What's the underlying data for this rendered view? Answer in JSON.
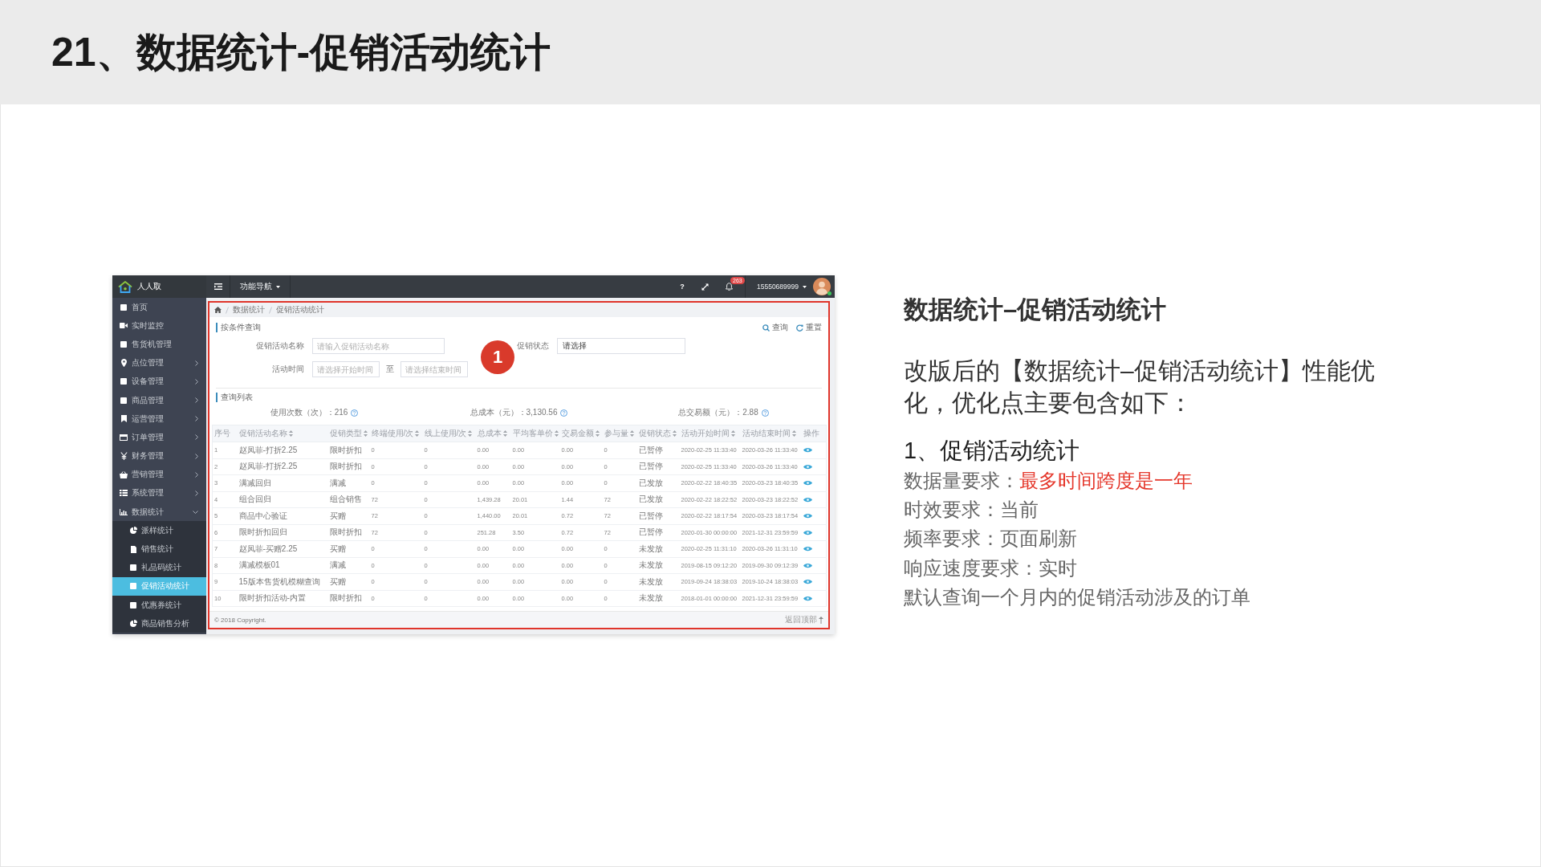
{
  "slide": {
    "title": "21、数据统计-促销活动统计"
  },
  "app": {
    "topbar": {
      "brand": "人人取",
      "nav_menu": "功能导航",
      "help": "?",
      "notification_count": "263",
      "user": "15550689999",
      "user_online": true
    },
    "sidebar": {
      "items": [
        {
          "label": "首页",
          "kind": "link",
          "selected": false
        },
        {
          "label": "实时监控",
          "kind": "link",
          "selected": false
        },
        {
          "label": "售货机管理",
          "kind": "link",
          "selected": false
        },
        {
          "label": "点位管理",
          "kind": "group",
          "expanded": false,
          "selected": false
        },
        {
          "label": "设备管理",
          "kind": "group",
          "expanded": false,
          "selected": false
        },
        {
          "label": "商品管理",
          "kind": "group",
          "expanded": false,
          "selected": false
        },
        {
          "label": "运营管理",
          "kind": "group",
          "expanded": false,
          "selected": false
        },
        {
          "label": "订单管理",
          "kind": "group",
          "expanded": false,
          "selected": false
        },
        {
          "label": "财务管理",
          "kind": "group",
          "expanded": false,
          "selected": false
        },
        {
          "label": "营销管理",
          "kind": "group",
          "expanded": false,
          "selected": false
        },
        {
          "label": "系统管理",
          "kind": "group",
          "expanded": false,
          "selected": false
        },
        {
          "label": "数据统计",
          "kind": "group",
          "expanded": true,
          "selected": false,
          "children": [
            {
              "label": "派样统计",
              "selected": false
            },
            {
              "label": "销售统计",
              "selected": false
            },
            {
              "label": "礼品码统计",
              "selected": false
            },
            {
              "label": "促销活动统计",
              "selected": true
            },
            {
              "label": "优惠券统计",
              "selected": false
            },
            {
              "label": "商品销售分析",
              "selected": false
            }
          ]
        }
      ]
    },
    "breadcrumb": [
      "数据统计",
      "促销活动统计"
    ],
    "search": {
      "title": "按条件查询",
      "buttons": [
        "查询",
        "重置"
      ],
      "fields": [
        {
          "kind": "text",
          "label": "促销活动名称",
          "placeholder": "请输入促销活动名称"
        },
        {
          "kind": "select",
          "label": "促销状态",
          "value": "请选择"
        },
        {
          "kind": "date-range",
          "label": "活动时间",
          "start": {
            "placeholder": "请选择开始时间"
          },
          "separator": "至",
          "end": {
            "placeholder": "请选择结束时间"
          }
        }
      ]
    },
    "list": {
      "title": "查询列表",
      "stats": [
        "使用次数（次）：216",
        "总成本（元）：3,130.56",
        "总交易额（元）：2.88"
      ],
      "table": {
        "columns": [
          {
            "label": "序号",
            "sortable": false
          },
          {
            "label": "促销活动名称",
            "sortable": true
          },
          {
            "label": "促销类型",
            "sortable": true
          },
          {
            "label": "终端使用/次",
            "sortable": true
          },
          {
            "label": "线上使用/次",
            "sortable": true
          },
          {
            "label": "总成本",
            "sortable": true
          },
          {
            "label": "平均客单价",
            "sortable": true
          },
          {
            "label": "交易金额",
            "sortable": true
          },
          {
            "label": "参与量",
            "sortable": true
          },
          {
            "label": "促销状态",
            "sortable": true
          },
          {
            "label": "活动开始时间",
            "sortable": true
          },
          {
            "label": "活动结束时间",
            "sortable": true
          },
          {
            "label": "操作",
            "sortable": false
          }
        ],
        "rows": [
          [
            "1",
            "赵凤菲-打折2.25",
            "限时折扣",
            "0",
            "0",
            "0.00",
            "0.00",
            "0.00",
            "0",
            "已暂停",
            "2020-02-25 11:33:40",
            "2020-03-26 11:33:40"
          ],
          [
            "2",
            "赵凤菲-打折2.25",
            "限时折扣",
            "0",
            "0",
            "0.00",
            "0.00",
            "0.00",
            "0",
            "已暂停",
            "2020-02-25 11:33:40",
            "2020-03-26 11:33:40"
          ],
          [
            "3",
            "满减回归",
            "满减",
            "0",
            "0",
            "0.00",
            "0.00",
            "0.00",
            "0",
            "已发放",
            "2020-02-22 18:40:35",
            "2020-03-23 18:40:35"
          ],
          [
            "4",
            "组合回归",
            "组合销售",
            "72",
            "0",
            "1,439.28",
            "20.01",
            "1.44",
            "72",
            "已发放",
            "2020-02-22 18:22:52",
            "2020-03-23 18:22:52"
          ],
          [
            "5",
            "商品中心验证",
            "买赠",
            "72",
            "0",
            "1,440.00",
            "20.01",
            "0.72",
            "72",
            "已暂停",
            "2020-02-22 18:17:54",
            "2020-03-23 18:17:54"
          ],
          [
            "6",
            "限时折扣回归",
            "限时折扣",
            "72",
            "0",
            "251.28",
            "3.50",
            "0.72",
            "72",
            "已暂停",
            "2020-01-30 00:00:00",
            "2021-12-31 23:59:59"
          ],
          [
            "7",
            "赵凤菲-买赠2.25",
            "买赠",
            "0",
            "0",
            "0.00",
            "0.00",
            "0.00",
            "0",
            "未发放",
            "2020-02-25 11:31:10",
            "2020-03-26 11:31:10"
          ],
          [
            "8",
            "满减模板01",
            "满减",
            "0",
            "0",
            "0.00",
            "0.00",
            "0.00",
            "0",
            "未发放",
            "2019-08-15 09:12:20",
            "2019-09-30 09:12:39"
          ],
          [
            "9",
            "15版本售货机模糊查询",
            "买赠",
            "0",
            "0",
            "0.00",
            "0.00",
            "0.00",
            "0",
            "未发放",
            "2019-09-24 18:38:03",
            "2019-10-24 18:38:03"
          ],
          [
            "10",
            "限时折扣活动-内置",
            "限时折扣",
            "0",
            "0",
            "0.00",
            "0.00",
            "0.00",
            "0",
            "未发放",
            "2018-01-01 00:00:00",
            "2021-12-31 23:59:59"
          ]
        ]
      }
    },
    "footer": {
      "copyright": "© 2018 Copyright.",
      "back_to_top": "返回顶部"
    }
  },
  "annotation": {
    "number": "1"
  },
  "notes": {
    "heading": "数据统计–促销活动统计",
    "intro": "改版后的【数据统计–促销活动统计】性能优化，优化点主要包含如下：",
    "section": "1、促销活动统计",
    "requirements": [
      {
        "label": "数据量要求：",
        "value": "最多时间跨度是一年",
        "highlight": true
      },
      {
        "label": "时效要求：",
        "value": "当前",
        "highlight": false
      },
      {
        "label": "频率要求：",
        "value": "页面刷新",
        "highlight": false
      },
      {
        "label": "响应速度要求：",
        "value": "实时",
        "highlight": false
      }
    ],
    "remark": "默认查询一个月内的促销活动涉及的订单"
  }
}
